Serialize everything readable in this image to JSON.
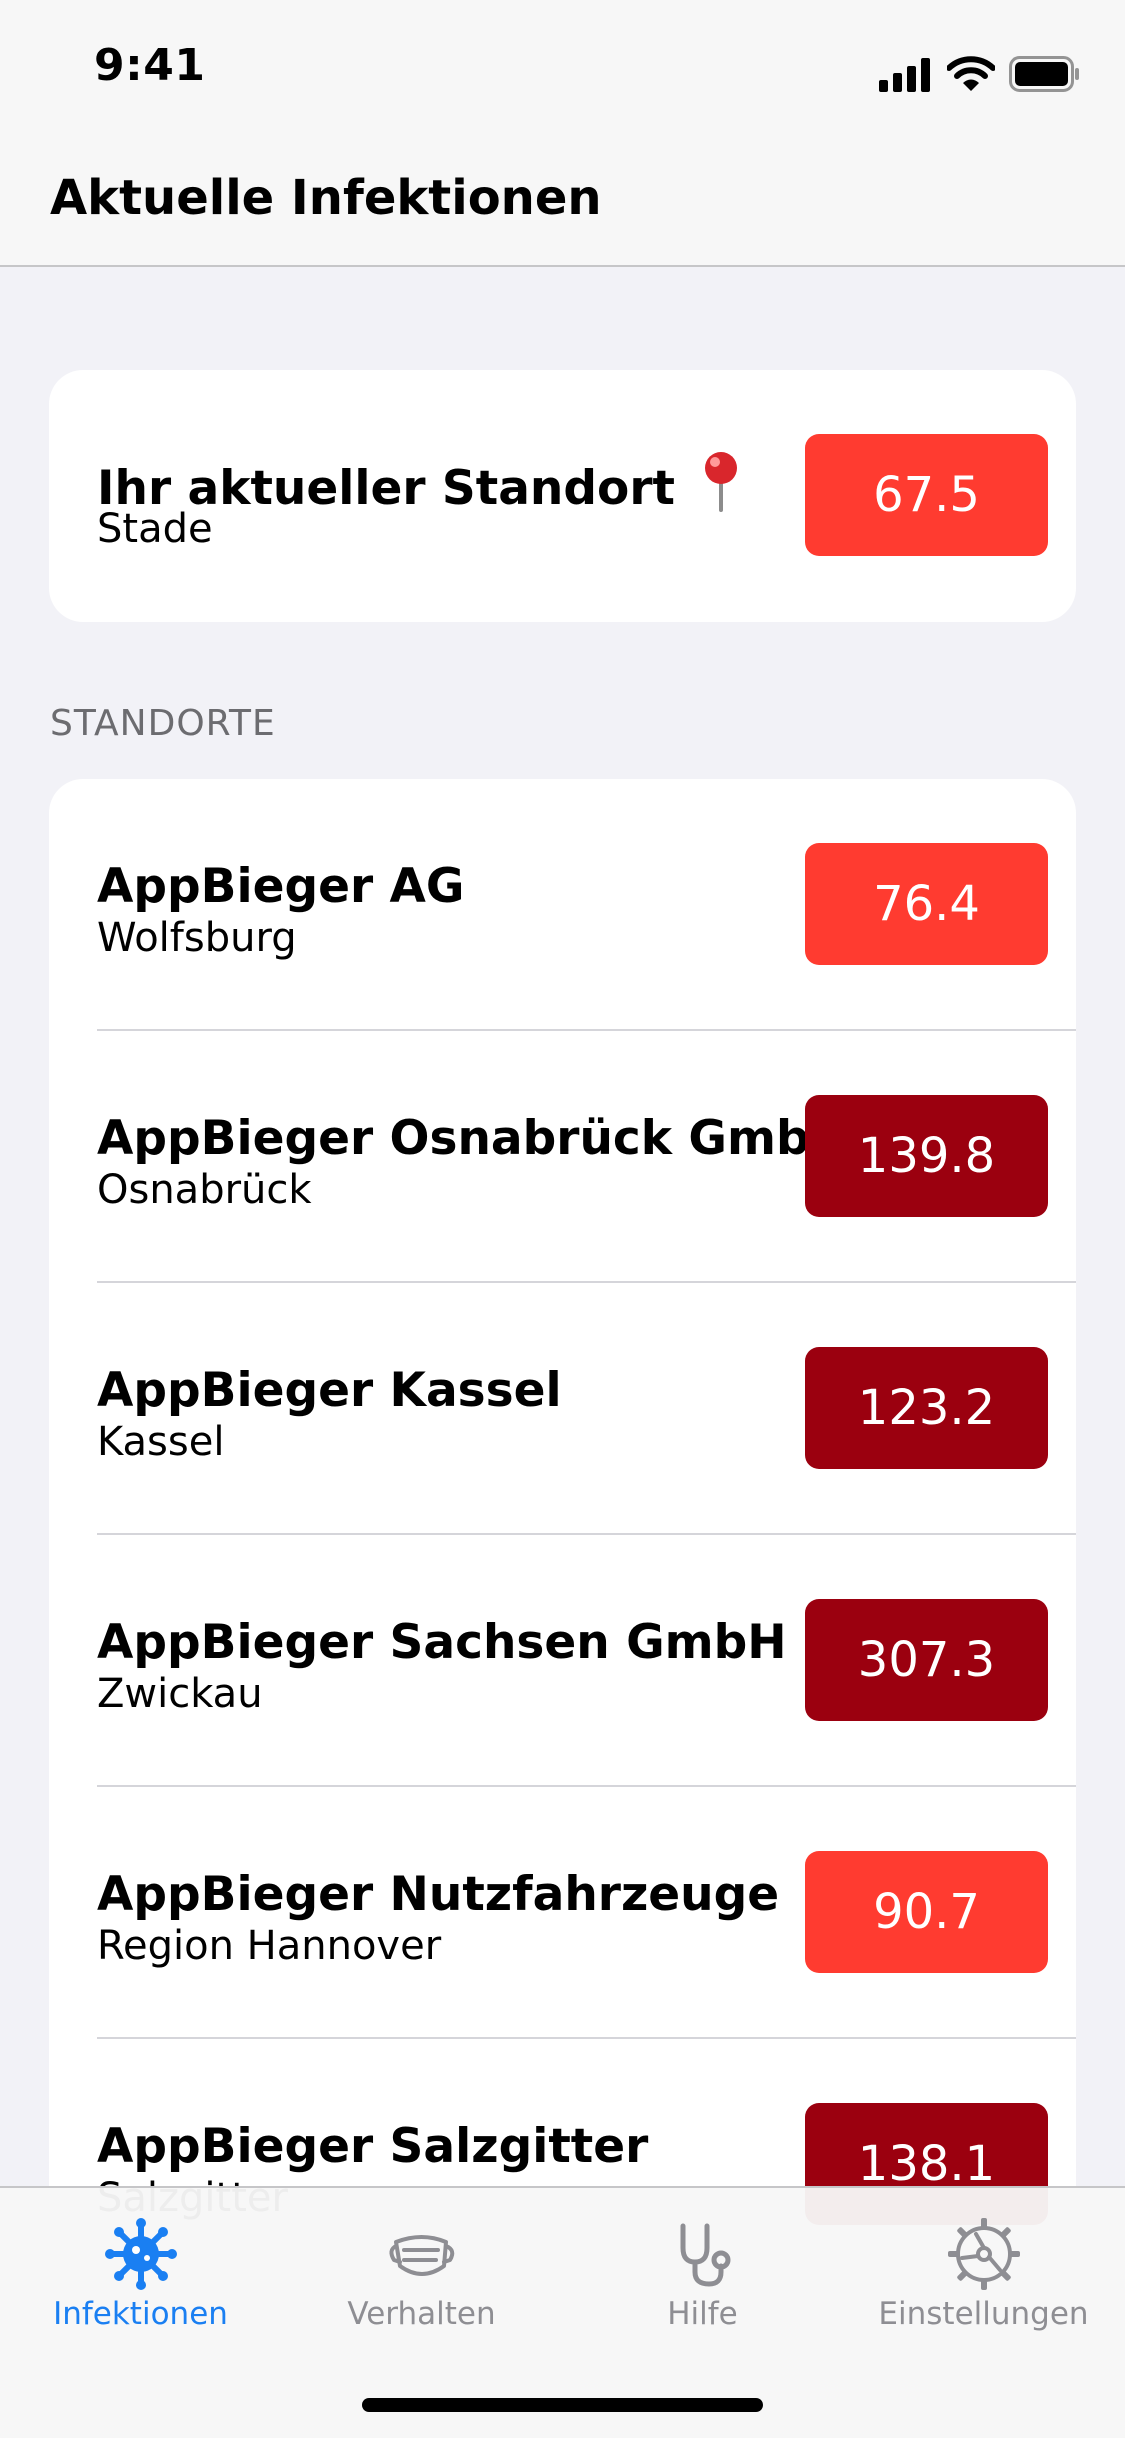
{
  "status_bar": {
    "time": "9:41"
  },
  "header": {
    "title": "Aktuelle Infektionen"
  },
  "current_location": {
    "title": "Ihr aktueller Standort",
    "pin_icon": "map-pin-icon",
    "subtitle": "Stade",
    "value": "67.5",
    "color": "#ff3b30"
  },
  "locations_section": {
    "header": "STANDORTE",
    "items": [
      {
        "title": "AppBieger AG",
        "subtitle": "Wolfsburg",
        "value": "76.4",
        "color": "#ff3b30"
      },
      {
        "title": "AppBieger Osnabrück GmbH",
        "subtitle": "Osnabrück",
        "value": "139.8",
        "color": "#9b000f"
      },
      {
        "title": "AppBieger Kassel",
        "subtitle": "Kassel",
        "value": "123.2",
        "color": "#9b000f"
      },
      {
        "title": "AppBieger Sachsen GmbH",
        "subtitle": "Zwickau",
        "value": "307.3",
        "color": "#9b000f"
      },
      {
        "title": "AppBieger Nutzfahrzeuge",
        "subtitle": "Region Hannover",
        "value": "90.7",
        "color": "#ff3b30"
      },
      {
        "title": "AppBieger Salzgitter",
        "subtitle": "Salzgitter",
        "value": "138.1",
        "color": "#9b000f"
      }
    ]
  },
  "tab_bar": {
    "active_color": "#1a7ff2",
    "inactive_color": "#8e8e93",
    "tabs": [
      {
        "label": "Infektionen",
        "icon": "virus-icon",
        "active": true
      },
      {
        "label": "Verhalten",
        "icon": "mask-icon",
        "active": false
      },
      {
        "label": "Hilfe",
        "icon": "stethoscope-icon",
        "active": false
      },
      {
        "label": "Einstellungen",
        "icon": "gear-icon",
        "active": false
      }
    ]
  }
}
